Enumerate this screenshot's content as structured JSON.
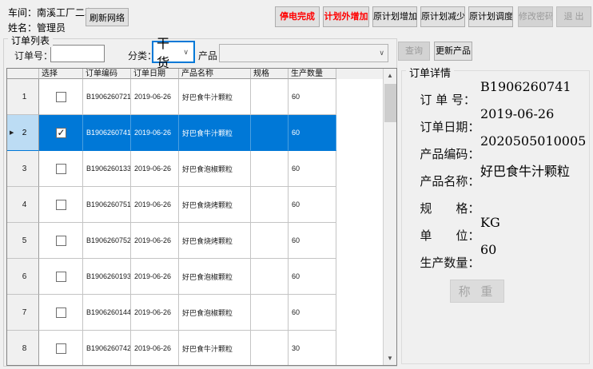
{
  "window": {
    "bg": "#f0f0f0",
    "accent": "#0078d7",
    "selected_row_color": "#0078d7",
    "alert_color": "#ff0000"
  },
  "header": {
    "workshop_label": "车间：",
    "workshop_value": "南溪工厂二车间",
    "name_label": "姓名：",
    "name_value": "管理员",
    "refresh_button": "刷新网络",
    "action_buttons": [
      {
        "label": "停电完成",
        "style": "red",
        "enabled": true
      },
      {
        "label": "计划外增加",
        "style": "red",
        "enabled": true
      },
      {
        "label": "原计划增加",
        "style": "normal",
        "enabled": true
      },
      {
        "label": "原计划减少",
        "style": "normal",
        "enabled": true
      },
      {
        "label": "原计划调度",
        "style": "normal",
        "enabled": true
      },
      {
        "label": "修改密码",
        "style": "disabled",
        "enabled": false
      },
      {
        "label": "退 出",
        "style": "disabled",
        "enabled": false
      }
    ]
  },
  "order_list": {
    "group_title": "订单列表",
    "filters": {
      "order_no_label": "订单号：",
      "order_no_value": "",
      "category_label": "分类：",
      "category_value": "干货",
      "product_label": "产品：",
      "product_value": "",
      "query_button": "查询",
      "update_product_button": "更新产品"
    },
    "table": {
      "columns": [
        "选择",
        "订单编码",
        "订单日期",
        "产品名称",
        "规格",
        "生产数量"
      ],
      "rows": [
        {
          "num": "1",
          "selected": false,
          "checked": false,
          "code": "B1906260721",
          "date": "2019-06-26",
          "product": "好巴食牛汁颗粒",
          "spec": "",
          "qty": "60"
        },
        {
          "num": "2",
          "selected": true,
          "checked": true,
          "code": "B1906260741",
          "date": "2019-06-26",
          "product": "好巴食牛汁颗粒",
          "spec": "",
          "qty": "60"
        },
        {
          "num": "3",
          "selected": false,
          "checked": false,
          "code": "B1906260133",
          "date": "2019-06-26",
          "product": "好巴食泡椒颗粒",
          "spec": "",
          "qty": "60"
        },
        {
          "num": "4",
          "selected": false,
          "checked": false,
          "code": "B1906260751",
          "date": "2019-06-26",
          "product": "好巴食烧烤颗粒",
          "spec": "",
          "qty": "60"
        },
        {
          "num": "5",
          "selected": false,
          "checked": false,
          "code": "B1906260752",
          "date": "2019-06-26",
          "product": "好巴食烧烤颗粒",
          "spec": "",
          "qty": "60"
        },
        {
          "num": "6",
          "selected": false,
          "checked": false,
          "code": "B1906260193",
          "date": "2019-06-26",
          "product": "好巴食泡椒颗粒",
          "spec": "",
          "qty": "60"
        },
        {
          "num": "7",
          "selected": false,
          "checked": false,
          "code": "B1906260144",
          "date": "2019-06-26",
          "product": "好巴食泡椒颗粒",
          "spec": "",
          "qty": "60"
        },
        {
          "num": "8",
          "selected": false,
          "checked": false,
          "code": "B1906260742",
          "date": "2019-06-26",
          "product": "好巴食牛汁颗粒",
          "spec": "",
          "qty": "30"
        }
      ]
    }
  },
  "order_detail": {
    "group_title": "订单详情",
    "fields": [
      {
        "label": "订 单 号：",
        "value": "B1906260741"
      },
      {
        "label": "订单日期：",
        "value": "2019-06-26"
      },
      {
        "label": "产品编码：",
        "value": "2020505010005"
      },
      {
        "label": "产品名称：",
        "value": "好巴食牛汁颗粒"
      },
      {
        "label": "规　　格：",
        "value": ""
      },
      {
        "label": "单　　位：",
        "value": "KG"
      },
      {
        "label": "生产数量：",
        "value": "60"
      }
    ],
    "weigh_button": "称 重"
  }
}
